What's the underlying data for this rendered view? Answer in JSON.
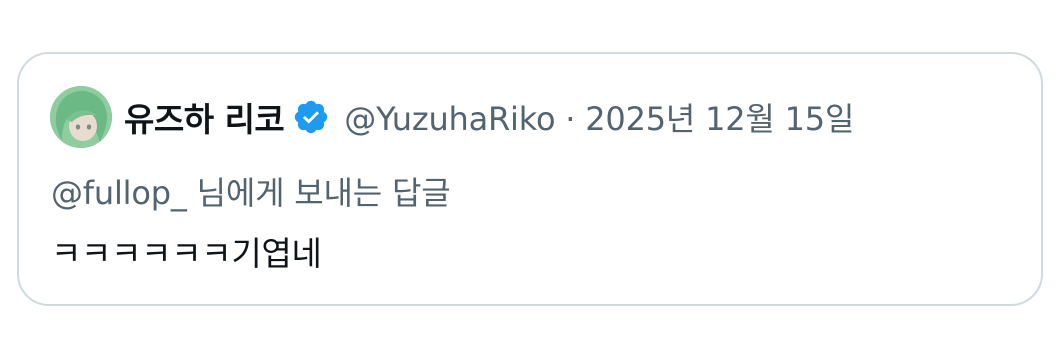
{
  "quoted_tweet": {
    "display_name": "유즈하 리코",
    "handle": "@YuzuhaRiko",
    "separator": " · ",
    "date": "2025년 12월 15일",
    "reply_to": "@fullop_ 님에게 보내는 답글",
    "text": "ㅋㅋㅋㅋㅋㅋ기엽네",
    "avatar_icon": "user-avatar",
    "verified_icon": "verified-badge-icon",
    "colors": {
      "verified": "#1d9bf0",
      "secondary_text": "#536471",
      "primary_text": "#0f1419",
      "border": "#cfd9de"
    }
  }
}
